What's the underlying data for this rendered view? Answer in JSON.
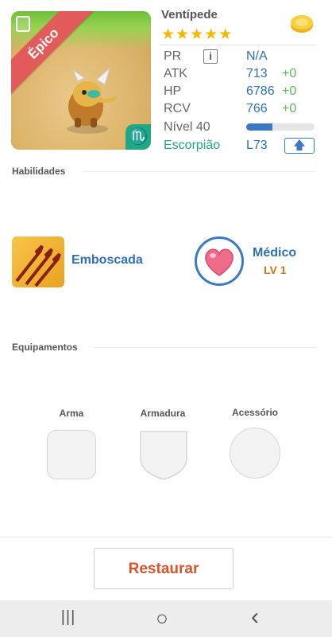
{
  "hero": {
    "name": "Ventípede",
    "stars": "★★★★★",
    "rarity": "Épico",
    "zodiac_symbol": "♏",
    "stats": {
      "pr_label": "PR",
      "pr_value": "N/A",
      "info_label": "i",
      "atk_label": "ATK",
      "atk_value": "713",
      "atk_bonus": "+0",
      "hp_label": "HP",
      "hp_value": "6786",
      "hp_bonus": "+0",
      "rcv_label": "RCV",
      "rcv_value": "766",
      "rcv_bonus": "+0",
      "level_label": "Nível 40",
      "level_progress": 0.38,
      "sign_label": "Escorpião",
      "sign_level": "L73",
      "upgrade_glyph": "🡅"
    }
  },
  "abilities": {
    "title": "Habilidades",
    "active": {
      "name": "Emboscada"
    },
    "passive": {
      "name": "Médico",
      "level": "LV 1"
    }
  },
  "equipment": {
    "title": "Equipamentos",
    "slots": [
      {
        "label": "Arma"
      },
      {
        "label": "Armadura"
      },
      {
        "label": "Acessório"
      }
    ]
  },
  "actions": {
    "restore_label": "Restaurar"
  },
  "navbar": {
    "recent_glyph": "|||",
    "home_glyph": "○",
    "back_glyph": "‹"
  },
  "colors": {
    "accent_blue": "#2f6fb5",
    "bonus_green": "#57b957",
    "rarity_red": "#e35a5a",
    "restore_orange": "#d8542c",
    "zodiac_green": "#1fa882"
  }
}
